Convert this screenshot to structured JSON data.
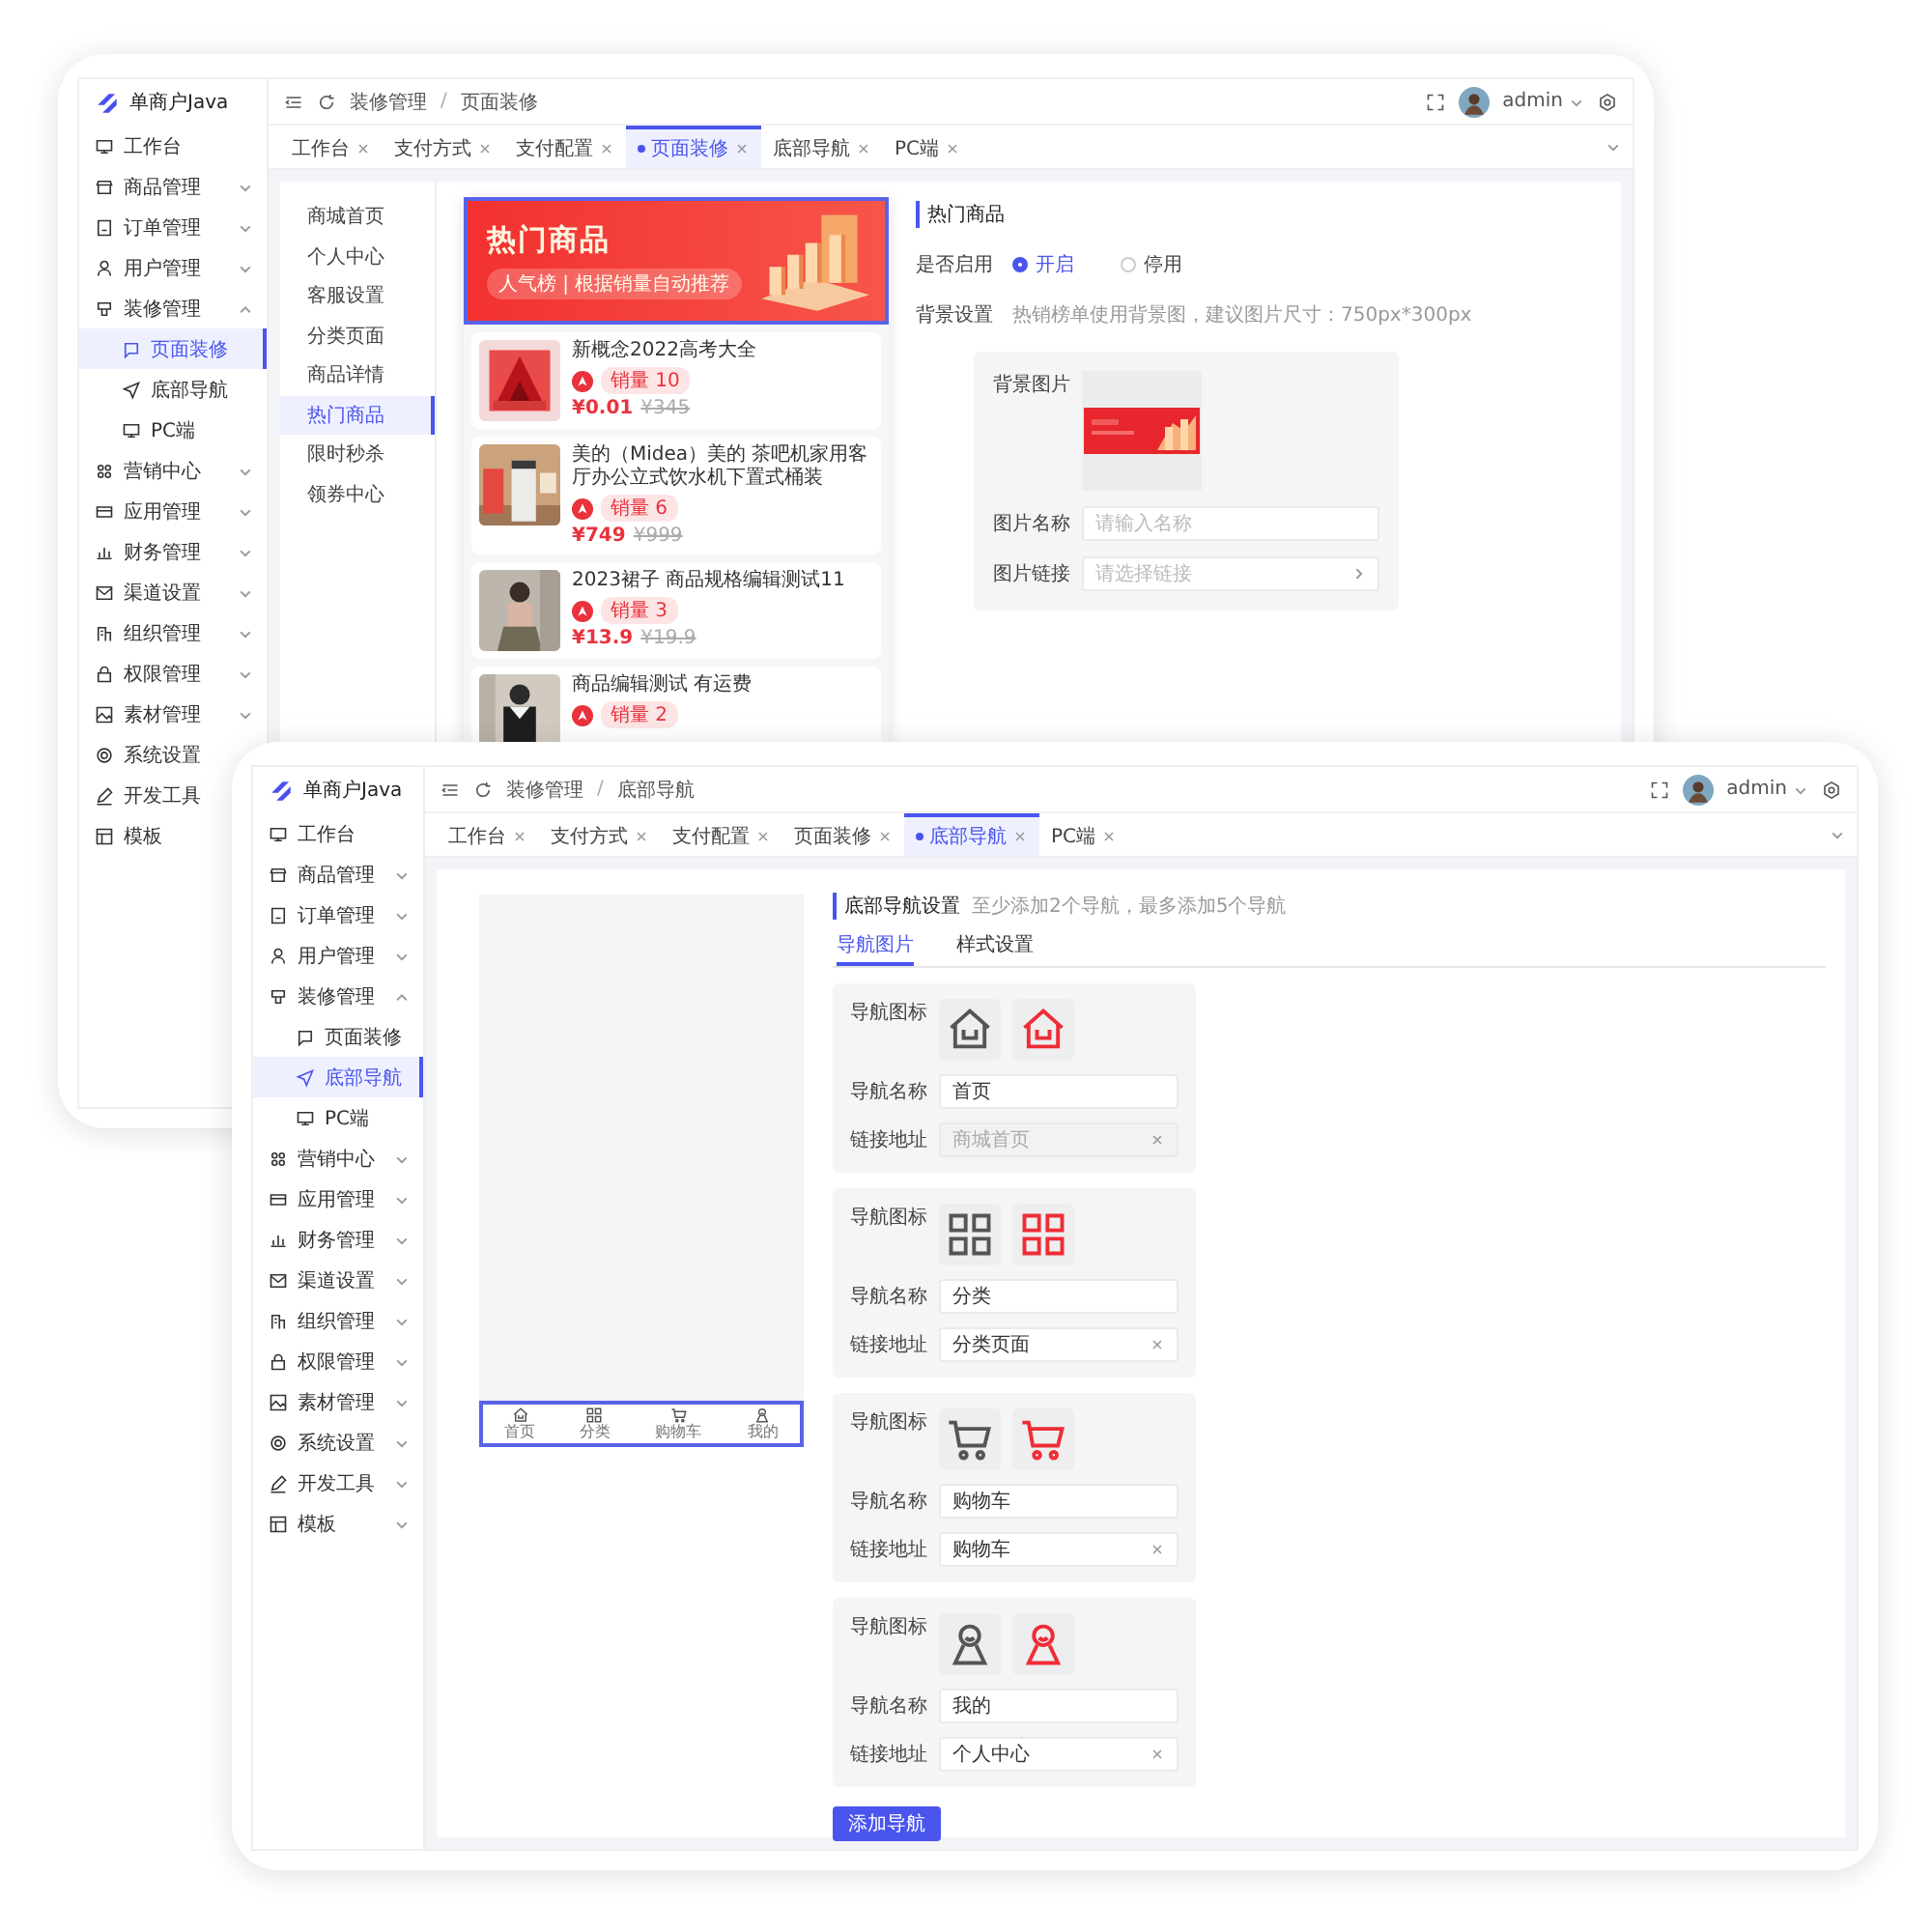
{
  "back_window": {
    "logo": "单商户Java",
    "sidebar": {
      "items": [
        {
          "label": "工作台",
          "selected": false
        },
        {
          "label": "商品管理",
          "selected": false,
          "expanded": false
        },
        {
          "label": "订单管理",
          "selected": false,
          "expanded": false
        },
        {
          "label": "用户管理",
          "selected": false,
          "expanded": false
        },
        {
          "label": "装修管理",
          "selected": false,
          "expanded": true,
          "children": [
            {
              "label": "页面装修",
              "selected": true
            },
            {
              "label": "底部导航",
              "selected": false
            },
            {
              "label": "PC端",
              "selected": false
            }
          ]
        },
        {
          "label": "营销中心",
          "selected": false,
          "expanded": false
        },
        {
          "label": "应用管理",
          "selected": false,
          "expanded": false
        },
        {
          "label": "财务管理",
          "selected": false,
          "expanded": false
        },
        {
          "label": "渠道设置",
          "selected": false,
          "expanded": false
        },
        {
          "label": "组织管理",
          "selected": false,
          "expanded": false
        },
        {
          "label": "权限管理",
          "selected": false,
          "expanded": false
        },
        {
          "label": "素材管理",
          "selected": false,
          "expanded": false
        },
        {
          "label": "系统设置",
          "selected": false
        },
        {
          "label": "开发工具",
          "selected": false
        },
        {
          "label": "模板",
          "selected": false
        }
      ]
    },
    "breadcrumb": [
      "装修管理",
      "页面装修"
    ],
    "breadcrumb_separator": "/",
    "user": "admin",
    "tabs": [
      {
        "label": "工作台",
        "selected": false
      },
      {
        "label": "支付方式",
        "selected": false
      },
      {
        "label": "支付配置",
        "selected": false
      },
      {
        "label": "页面装修",
        "selected": true
      },
      {
        "label": "底部导航",
        "selected": false
      },
      {
        "label": "PC端",
        "selected": false
      }
    ],
    "page_menu": [
      {
        "label": "商城首页",
        "selected": false
      },
      {
        "label": "个人中心",
        "selected": false
      },
      {
        "label": "客服设置",
        "selected": false
      },
      {
        "label": "分类页面",
        "selected": false
      },
      {
        "label": "商品详情",
        "selected": false
      },
      {
        "label": "热门商品",
        "selected": true
      },
      {
        "label": "限时秒杀",
        "selected": false
      },
      {
        "label": "领券中心",
        "selected": false
      }
    ],
    "preview": {
      "banner": {
        "title": "热门商品",
        "subtitle": "人气榜 | 根据销量自动推荐",
        "selected": true
      },
      "products": [
        {
          "name": "新概念2022高考大全",
          "sales": "销量 10",
          "price": "¥0.01",
          "original_price": "¥345"
        },
        {
          "name": "美的（Midea）美的 茶吧机家用客厅办公立式饮水机下置式桶装",
          "sales": "销量 6",
          "price": "¥749",
          "original_price": "¥999"
        },
        {
          "name": "2023裙子 商品规格编辑测试11",
          "sales": "销量 3",
          "price": "¥13.9",
          "original_price": "¥19.9"
        },
        {
          "name": "商品编辑测试 有运费",
          "sales": "销量 2"
        }
      ]
    },
    "settings": {
      "title": "热门商品",
      "enable": {
        "label": "是否启用",
        "options": [
          {
            "label": "开启",
            "selected": true
          },
          {
            "label": "停用",
            "selected": false
          }
        ]
      },
      "background": {
        "label": "背景设置",
        "hint": "热销榜单使用背景图，建议图片尺寸：750px*300px"
      },
      "image_label": "背景图片",
      "name_field": {
        "label": "图片名称",
        "placeholder": "请输入名称"
      },
      "link_field": {
        "label": "图片链接",
        "placeholder": "请选择链接"
      }
    }
  },
  "front_window": {
    "logo": "单商户Java",
    "sidebar": {
      "items": [
        {
          "label": "工作台",
          "selected": false
        },
        {
          "label": "商品管理",
          "selected": false,
          "expanded": false
        },
        {
          "label": "订单管理",
          "selected": false,
          "expanded": false
        },
        {
          "label": "用户管理",
          "selected": false,
          "expanded": false
        },
        {
          "label": "装修管理",
          "selected": false,
          "expanded": true,
          "children": [
            {
              "label": "页面装修",
              "selected": false
            },
            {
              "label": "底部导航",
              "selected": true
            },
            {
              "label": "PC端",
              "selected": false
            }
          ]
        },
        {
          "label": "营销中心",
          "selected": false,
          "expanded": false
        },
        {
          "label": "应用管理",
          "selected": false,
          "expanded": false
        },
        {
          "label": "财务管理",
          "selected": false,
          "expanded": false
        },
        {
          "label": "渠道设置",
          "selected": false,
          "expanded": false
        },
        {
          "label": "组织管理",
          "selected": false,
          "expanded": false
        },
        {
          "label": "权限管理",
          "selected": false,
          "expanded": false
        },
        {
          "label": "素材管理",
          "selected": false,
          "expanded": false
        },
        {
          "label": "系统设置",
          "selected": false,
          "expanded": false
        },
        {
          "label": "开发工具",
          "selected": false,
          "expanded": false
        },
        {
          "label": "模板",
          "selected": false,
          "expanded": false
        }
      ]
    },
    "breadcrumb": [
      "装修管理",
      "底部导航"
    ],
    "breadcrumb_separator": "/",
    "user": "admin",
    "tabs": [
      {
        "label": "工作台",
        "selected": false
      },
      {
        "label": "支付方式",
        "selected": false
      },
      {
        "label": "支付配置",
        "selected": false
      },
      {
        "label": "页面装修",
        "selected": false
      },
      {
        "label": "底部导航",
        "selected": true
      },
      {
        "label": "PC端",
        "selected": false
      }
    ],
    "preview": {
      "nav": [
        {
          "kind": "home",
          "label": "首页"
        },
        {
          "kind": "grid",
          "label": "分类"
        },
        {
          "kind": "cart",
          "label": "购物车"
        },
        {
          "kind": "user",
          "label": "我的"
        }
      ]
    },
    "settings": {
      "title": "底部导航设置",
      "hint": "至少添加2个导航，最多添加5个导航",
      "tabs": [
        {
          "label": "导航图片",
          "selected": true
        },
        {
          "label": "样式设置",
          "selected": false
        }
      ],
      "items": [
        {
          "kind": "home",
          "icon_label": "导航图标",
          "name_label": "导航名称",
          "name": "首页",
          "link_label": "链接地址",
          "link": "商城首页",
          "link_disabled": true
        },
        {
          "kind": "grid",
          "icon_label": "导航图标",
          "name_label": "导航名称",
          "name": "分类",
          "link_label": "链接地址",
          "link": "分类页面",
          "link_disabled": false
        },
        {
          "kind": "cart",
          "icon_label": "导航图标",
          "name_label": "导航名称",
          "name": "购物车",
          "link_label": "链接地址",
          "link": "购物车",
          "link_disabled": false
        },
        {
          "kind": "user",
          "icon_label": "导航图标",
          "name_label": "导航名称",
          "name": "我的",
          "link_label": "链接地址",
          "link": "个人中心",
          "link_disabled": false
        }
      ],
      "add_button": "添加导航"
    }
  }
}
